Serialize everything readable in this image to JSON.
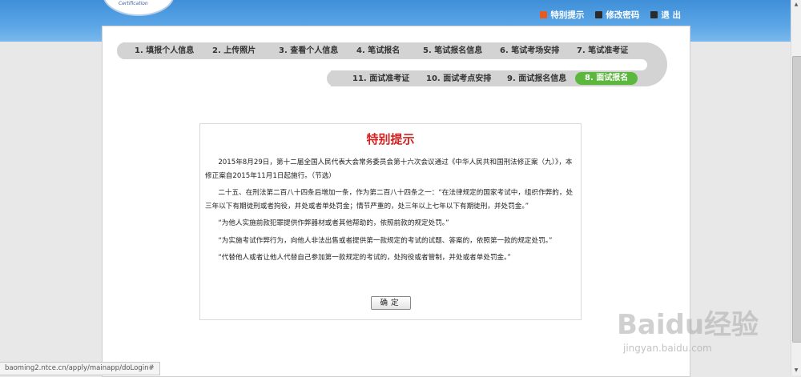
{
  "header": {
    "logo_text": "Certification",
    "links": [
      {
        "label": "特别提示",
        "icon": "notice-icon",
        "color": "#e85a1e"
      },
      {
        "label": "修改密码",
        "icon": "password-icon",
        "color": "#333333"
      },
      {
        "label": "退 出",
        "icon": "logout-icon",
        "color": "#333333"
      }
    ]
  },
  "steps": {
    "row1": [
      "1. 填报个人信息",
      "2. 上传照片",
      "3. 查看个人信息",
      "4. 笔试报名",
      "5. 笔试报名信息",
      "6. 笔试考场安排",
      "7. 笔试准考证"
    ],
    "row2": [
      "11. 面试准考证",
      "10. 面试考点安排",
      "9. 面试报名信息",
      "8. 面试报名"
    ],
    "active_color": "#5cb83d"
  },
  "dialog": {
    "title": "特别提示",
    "paragraphs": [
      "2015年8月29日，第十二届全国人民代表大会常务委员会第十六次会议通过《中华人民共和国刑法修正案（九）》，本修正案自2015年11月1日起施行。（节选）",
      "二十五、在刑法第二百八十四条后增加一条，作为第二百八十四条之一：“在法律规定的国家考试中，组织作弊的，处三年以下有期徒刑或者拘役，并处或者单处罚金；情节严重的，处三年以上七年以下有期徒刑，并处罚金。”",
      "“为他人实施前款犯罪提供作弊器材或者其他帮助的，依照前款的规定处罚。”",
      "“为实施考试作弊行为，向他人非法出售或者提供第一款规定的考试的试题、答案的，依照第一款的规定处罚。”",
      "“代替他人或者让他人代替自己参加第一款规定的考试的，处拘役或者管制，并处或者单处罚金。”"
    ],
    "ok_label": "确定",
    "title_color": "#d42020"
  },
  "statusbar": {
    "url": "baoming2.ntce.cn/apply/mainapp/doLogin#"
  },
  "watermark": {
    "main": "Baidu经验",
    "sub": "jingyan.baidu.com"
  }
}
